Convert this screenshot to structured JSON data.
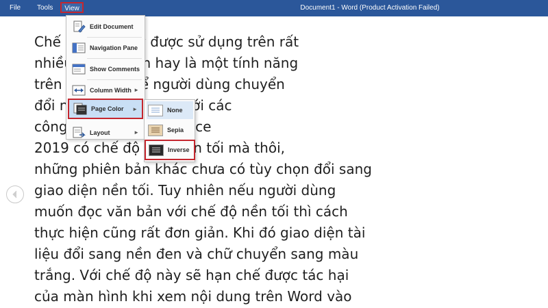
{
  "menubar": {
    "items": [
      "File",
      "Tools",
      "View"
    ],
    "title": "Document1 - Word (Product Activation Failed)",
    "background_color": "#2b579a"
  },
  "view_menu": {
    "items": [
      {
        "label": "Edit Document",
        "icon": "edit-document-icon"
      },
      {
        "label": "Navigation Pane",
        "icon": "navigation-pane-icon"
      },
      {
        "label": "Show Comments",
        "icon": "show-comments-icon"
      },
      {
        "label": "Column Width",
        "icon": "column-width-icon",
        "has_submenu": true
      },
      {
        "label": "Page Color",
        "icon": "page-color-icon",
        "has_submenu": true,
        "highlighted": true
      },
      {
        "label": "Layout",
        "icon": "layout-icon",
        "has_submenu": true
      }
    ]
  },
  "page_color_submenu": {
    "items": [
      {
        "label": "None",
        "icon": "page-none-icon"
      },
      {
        "label": "Sepia",
        "icon": "page-sepia-icon"
      },
      {
        "label": "Inverse",
        "icon": "page-inverse-icon",
        "highlighted": true
      }
    ]
  },
  "document": {
    "lines": [
      "Chế độ hiện nay được sử dụng trên rất",
      "nhiều phần mềm hay là một tính năng",
      "trên máy tính để người dùng chuyển",
      "đổi nhu cầu sử dụng. Với các",
      "công với chỉ có bản Office",
      "2019 có chế độ Dde nền tối mà thôi,",
      "những phiên bản khác chưa có tùy chọn đổi sang",
      "giao diện nền tối. Tuy nhiên nếu người dùng",
      "muốn đọc văn bản với chế độ nền tối thì cách",
      "thực hiện cũng rất đơn giản. Khi đó giao diện tài",
      "liệu đổi sang nền đen và chữ chuyển sang màu",
      "trắng. Với chế độ này sẽ hạn chế được tác hại",
      "của màn hình khi xem nội dung trên Word vào"
    ]
  },
  "nav": {
    "prev_icon": "chevron-left-icon"
  },
  "colors": {
    "highlight_border": "#c4262e",
    "menu_hover": "#c9dff5"
  }
}
